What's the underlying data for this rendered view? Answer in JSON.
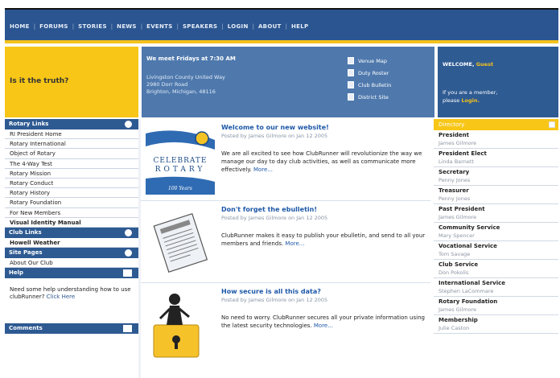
{
  "nav": {
    "items": [
      "HOME",
      "FORUMS",
      "STORIES",
      "NEWS",
      "EVENTS",
      "SPEAKERS",
      "LOGIN",
      "ABOUT",
      "HELP"
    ]
  },
  "tagline": "Is it the truth?",
  "meeting": {
    "title": "We meet Fridays at 7:30 AM",
    "address_line1": "Livingston County United Way",
    "address_line2": "2980 Dorr Road",
    "address_line3": "Brighton, Michigan, 48116",
    "quick_links": [
      "Venue Map",
      "Duty Roster",
      "Club Bulletin",
      "District Site"
    ]
  },
  "welcome": {
    "label": "WELCOME,",
    "name": "Guest",
    "member_text": "If you are a member,",
    "please": "please",
    "login": "Login."
  },
  "sidebar": {
    "rotary_links_title": "Rotary Links",
    "rotary_links": [
      "RI President Home",
      "Rotary International",
      "Object of Rotary",
      "The 4-Way Test",
      "Rotary Mission",
      "Rotary Conduct",
      "Rotary History",
      "Rotary Foundation",
      "For New Members",
      "Visual Identity Manual"
    ],
    "club_links_title": "Club Links",
    "club_links": [
      "Howell Weather"
    ],
    "site_pages_title": "Site Pages",
    "site_pages": [
      "About Our Club"
    ],
    "help_title": "Help",
    "help_text": "Need some help understanding how to use clubRunner?",
    "help_link": "Click Here",
    "comments_title": "Comments"
  },
  "posts": [
    {
      "title": "Welcome to our new website!",
      "byline": "Posted by James Gilmore on Jan 12 2005",
      "body": "We are all excited to see how ClubRunner will revolutionize the way we manage our day to day club activities, as well as communicate more effectively.",
      "more": "More...",
      "image_text_1": "CELEBRATE",
      "image_text_2": "ROTARY",
      "image_text_3": "100 Years"
    },
    {
      "title": "Don't forget the ebulletin!",
      "byline": "Posted by James Gilmore on Jan 12 2005",
      "body": "ClubRunner makes it easy to publish your ebulletin, and send to all your members and friends.",
      "more": "More..."
    },
    {
      "title": "How secure is all this data?",
      "byline": "Posted by James Gilmore on Jan 12 2005",
      "body": "No need to worry. ClubRunner secures all your private information using the latest security technologies.",
      "more": "More..."
    }
  ],
  "directory": {
    "title": "Directory",
    "roles": [
      {
        "role": "President",
        "name": "James Gilmore"
      },
      {
        "role": "President Elect",
        "name": "Linda Barnett"
      },
      {
        "role": "Secretary",
        "name": "Penny Jones"
      },
      {
        "role": "Treasurer",
        "name": "Penny Jones"
      },
      {
        "role": "Past President",
        "name": "James Gilmore"
      },
      {
        "role": "Community Service",
        "name": "Mary Spencer"
      },
      {
        "role": "Vocational Service",
        "name": "Tom Savage"
      },
      {
        "role": "Club Service",
        "name": "Don Pokolis"
      },
      {
        "role": "International Service",
        "name": "Stephen LaCommare"
      },
      {
        "role": "Rotary Foundation",
        "name": "James Gilmore"
      },
      {
        "role": "Membership",
        "name": "Julie Caston"
      }
    ]
  }
}
